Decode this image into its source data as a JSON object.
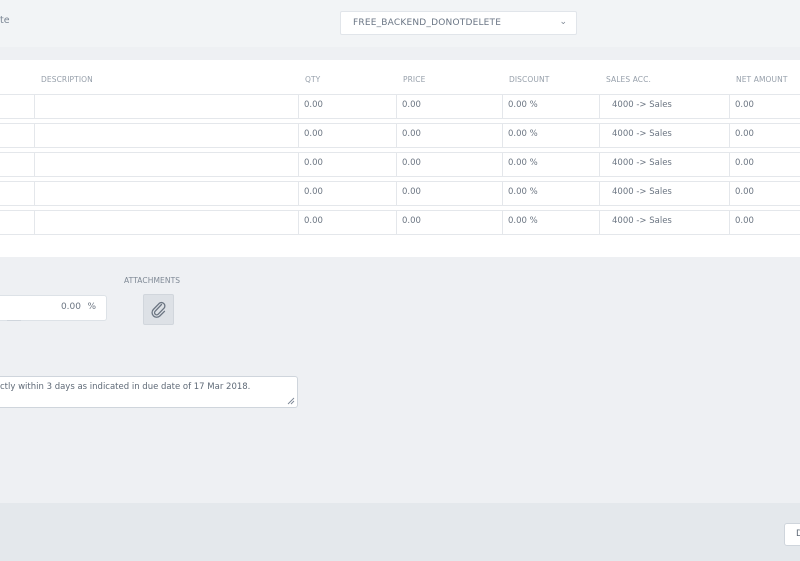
{
  "header": {
    "template_label": "te",
    "template_select_value": "FREE_BACKEND_DONOTDELETE"
  },
  "table": {
    "columns": [
      "DESCRIPTION",
      "QTY",
      "PRICE",
      "DISCOUNT",
      "SALES ACC.",
      "NET AMOUNT"
    ],
    "rows": [
      {
        "description": "",
        "qty": "0.00",
        "price": "0.00",
        "discount": "0.00 %",
        "sales_acc": "4000 -> Sales",
        "net_amount": "0.00"
      },
      {
        "description": "",
        "qty": "0.00",
        "price": "0.00",
        "discount": "0.00 %",
        "sales_acc": "4000 -> Sales",
        "net_amount": "0.00"
      },
      {
        "description": "",
        "qty": "0.00",
        "price": "0.00",
        "discount": "0.00 %",
        "sales_acc": "4000 -> Sales",
        "net_amount": "0.00"
      },
      {
        "description": "",
        "qty": "0.00",
        "price": "0.00",
        "discount": "0.00 %",
        "sales_acc": "4000 -> Sales",
        "net_amount": "0.00"
      },
      {
        "description": "",
        "qty": "0.00",
        "price": "0.00",
        "discount": "0.00 %",
        "sales_acc": "4000 -> Sales",
        "net_amount": "0.00"
      }
    ]
  },
  "lower": {
    "percent_value": "0.00",
    "percent_symbol": "%",
    "attachments_label": "ATTACHMENTS",
    "attach_icon": "paperclip-icon",
    "terms_text": "ctly within 3 days as indicated in due date of 17 Mar 2018."
  },
  "footer": {
    "button_label": "D"
  }
}
